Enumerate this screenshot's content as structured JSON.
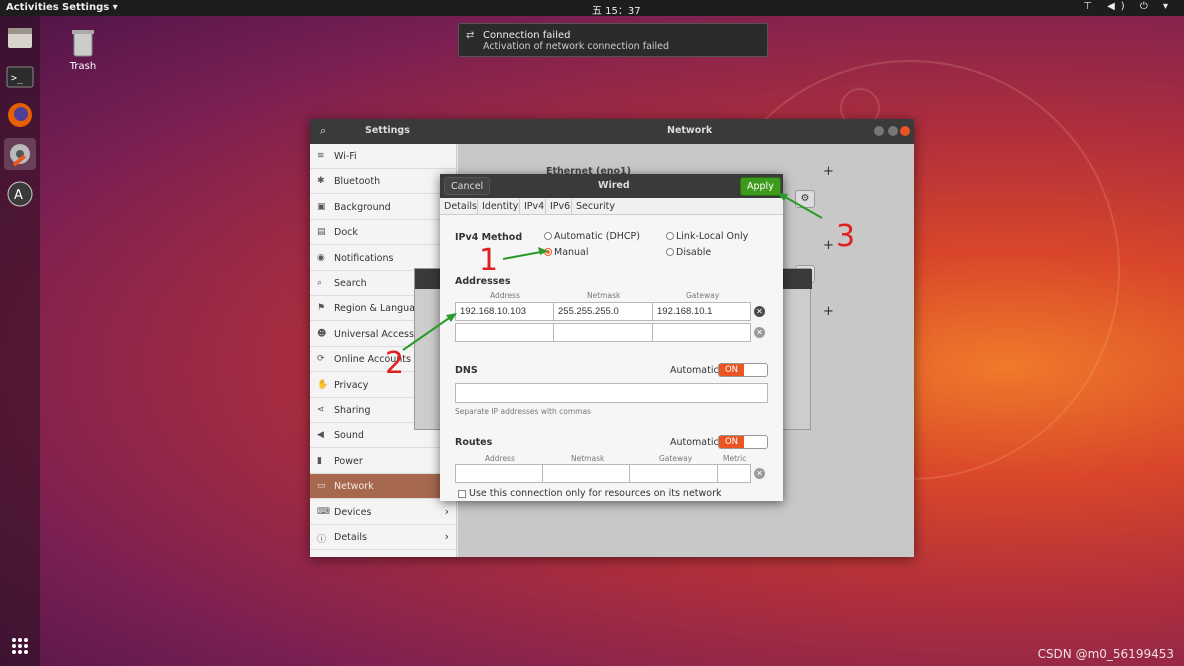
{
  "topbar": {
    "activities": "Activities",
    "app_menu": "Settings ▾",
    "clock": "五 15：37",
    "system_icons": "⊤ ◀) ⏻ ▾"
  },
  "desktop": {
    "trash_label": "Trash"
  },
  "notification": {
    "title": "Connection failed",
    "body": "Activation of network connection failed"
  },
  "settings": {
    "sidebar_title": "Settings",
    "panel_title": "Network",
    "sidebar": [
      {
        "icon": "wifi-icon",
        "glyph": "≋",
        "label": "Wi-Fi"
      },
      {
        "icon": "bluetooth-icon",
        "glyph": "✱",
        "label": "Bluetooth"
      },
      {
        "icon": "background-icon",
        "glyph": "▣",
        "label": "Background"
      },
      {
        "icon": "dock-icon",
        "glyph": "▤",
        "label": "Dock"
      },
      {
        "icon": "bell-icon",
        "glyph": "◉",
        "label": "Notifications"
      },
      {
        "icon": "search-icon",
        "glyph": "⌕",
        "label": "Search"
      },
      {
        "icon": "flag-icon",
        "glyph": "⚑",
        "label": "Region & Language"
      },
      {
        "icon": "accessibility-icon",
        "glyph": "☻",
        "label": "Universal Access"
      },
      {
        "icon": "online-accounts-icon",
        "glyph": "⟳",
        "label": "Online Accounts"
      },
      {
        "icon": "privacy-icon",
        "glyph": "✋",
        "label": "Privacy"
      },
      {
        "icon": "share-icon",
        "glyph": "⋖",
        "label": "Sharing"
      },
      {
        "icon": "sound-icon",
        "glyph": "◀",
        "label": "Sound"
      },
      {
        "icon": "power-icon",
        "glyph": "▮",
        "label": "Power"
      },
      {
        "icon": "network-icon",
        "glyph": "▭",
        "label": "Network"
      },
      {
        "icon": "devices-icon",
        "glyph": "⌨",
        "label": "Devices"
      },
      {
        "icon": "details-icon",
        "glyph": "ⓘ",
        "label": "Details"
      }
    ],
    "ethernet_heading": "Ethernet (eno1)"
  },
  "wired": {
    "title": "Wired",
    "cancel": "Cancel",
    "apply": "Apply",
    "tabs": [
      "Details",
      "Identity",
      "IPv4",
      "IPv6",
      "Security"
    ],
    "ipv4_method_label": "IPv4 Method",
    "methods": {
      "dhcp": "Automatic (DHCP)",
      "link_local": "Link-Local Only",
      "manual": "Manual",
      "disable": "Disable"
    },
    "selected_method": "Manual",
    "addresses_label": "Addresses",
    "col_address": "Address",
    "col_netmask": "Netmask",
    "col_gateway": "Gateway",
    "col_metric": "Metric",
    "address_row": {
      "address": "192.168.10.103",
      "netmask": "255.255.255.0",
      "gateway": "192.168.10.1"
    },
    "dns_label": "DNS",
    "automatic": "Automatic",
    "toggle_on": "ON",
    "dns_hint": "Separate IP addresses with commas",
    "routes_label": "Routes",
    "only_resources": "Use this connection only for resources on its network"
  },
  "annotations": [
    "1",
    "2",
    "3"
  ],
  "watermark": "CSDN @m0_56199453"
}
